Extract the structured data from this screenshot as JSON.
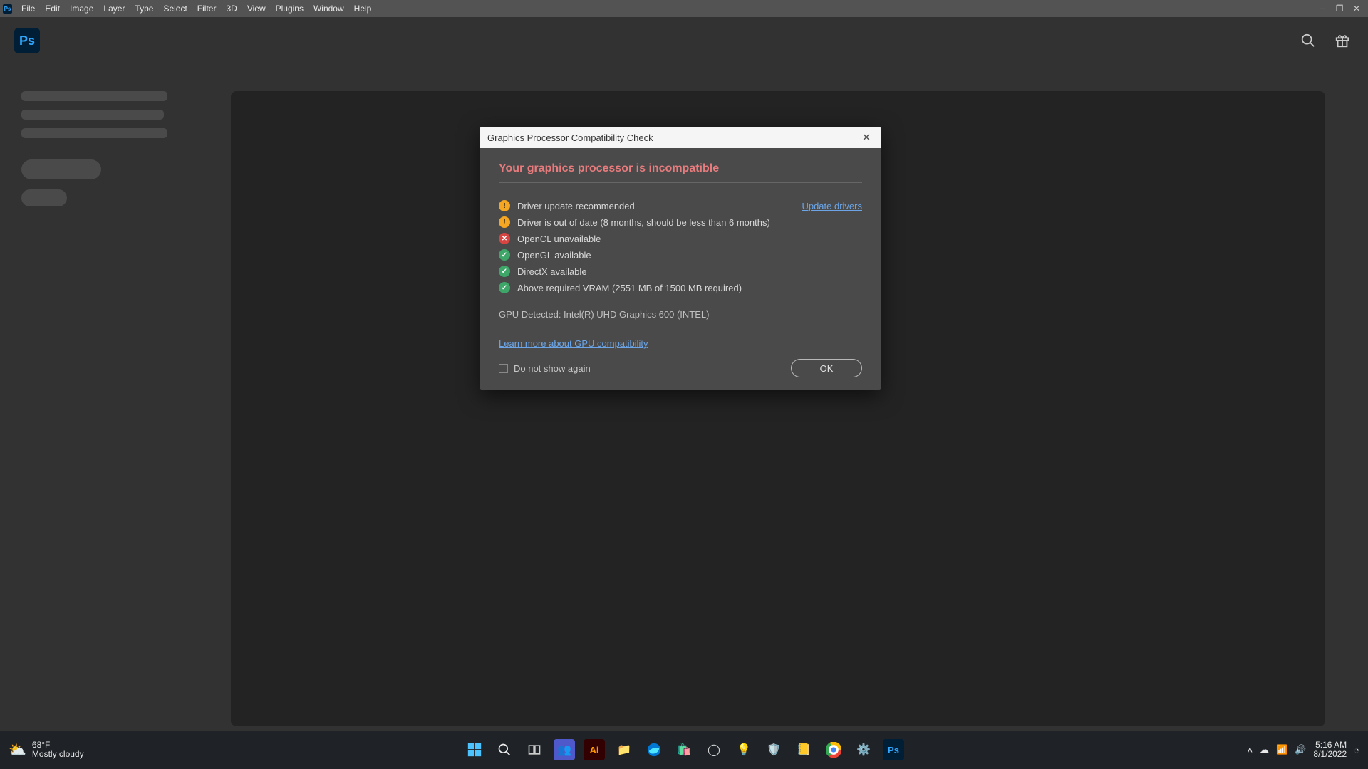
{
  "menubar": {
    "items": [
      "File",
      "Edit",
      "Image",
      "Layer",
      "Type",
      "Select",
      "Filter",
      "3D",
      "View",
      "Plugins",
      "Window",
      "Help"
    ]
  },
  "dialog": {
    "title": "Graphics Processor Compatibility Check",
    "headline": "Your graphics processor is incompatible",
    "rows": [
      {
        "status": "warn",
        "text": "Driver update recommended",
        "link": "Update drivers"
      },
      {
        "status": "warn",
        "text": "Driver is out of date (8 months, should be less than 6 months)"
      },
      {
        "status": "err",
        "text": "OpenCL unavailable"
      },
      {
        "status": "ok",
        "text": "OpenGL available"
      },
      {
        "status": "ok",
        "text": "DirectX available"
      },
      {
        "status": "ok",
        "text": "Above required VRAM (2551 MB of 1500 MB required)"
      }
    ],
    "gpu_line": "GPU Detected: Intel(R) UHD Graphics 600 (INTEL)",
    "learn_more": "Learn more about GPU compatibility",
    "dns_label": "Do not show again",
    "ok_label": "OK"
  },
  "taskbar": {
    "weather": {
      "temp": "68°F",
      "desc": "Mostly cloudy"
    },
    "clock": {
      "time": "5:16 AM",
      "date": "8/1/2022"
    }
  }
}
